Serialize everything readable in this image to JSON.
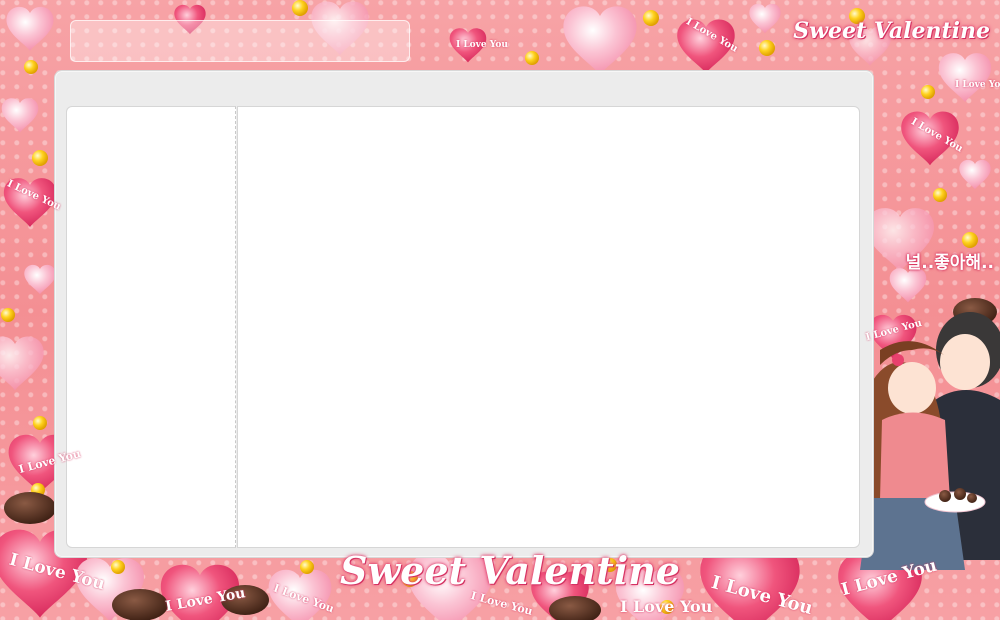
{
  "titles": {
    "top": "Sweet Valentine",
    "bottom": "Sweet Valentine"
  },
  "labels": {
    "i_love_you": "I Love You",
    "korean": "널..좋아해.."
  },
  "colors": {
    "background": "#f59a9a",
    "frame": "#ececec",
    "panel": "#ffffff",
    "heart_pink": "#f6a6c0",
    "heart_red": "#e8416d"
  }
}
